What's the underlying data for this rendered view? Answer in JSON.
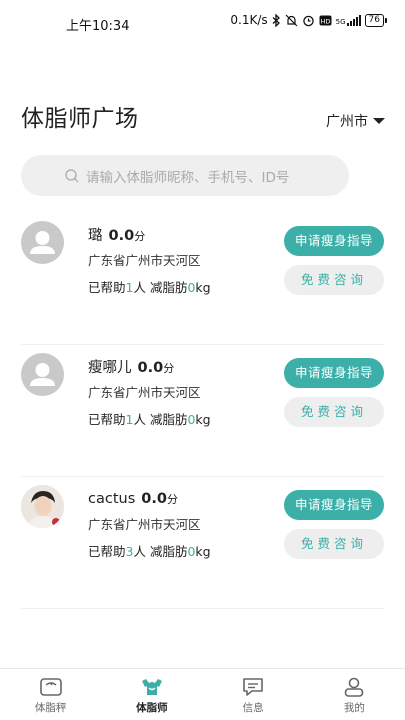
{
  "status_bar": {
    "time": "上午10:34",
    "network_speed": "0.1K/s",
    "network_type": "5G",
    "battery": "76"
  },
  "header": {
    "title": "体脂师广场",
    "city": "广州市"
  },
  "search": {
    "placeholder": "请输入体脂师昵称、手机号、ID号"
  },
  "coaches": [
    {
      "name": "璐",
      "score": "0.0",
      "score_unit": "分",
      "region": "广东省广州市天河区",
      "helped_prefix": "已帮助",
      "helped_count": "1",
      "helped_suffix": "人 减脂肪",
      "fat_lost": "0",
      "fat_unit": "kg",
      "apply_label": "申请瘦身指导",
      "consult_label": "免费咨询",
      "avatar": "default-avatar"
    },
    {
      "name": "瘦哪儿",
      "score": "0.0",
      "score_unit": "分",
      "region": "广东省广州市天河区",
      "helped_prefix": "已帮助",
      "helped_count": "1",
      "helped_suffix": "人 减脂肪",
      "fat_lost": "0",
      "fat_unit": "kg",
      "apply_label": "申请瘦身指导",
      "consult_label": "免费咨询",
      "avatar": "default-avatar"
    },
    {
      "name": "cactus",
      "score": "0.0",
      "score_unit": "分",
      "region": "广东省广州市天河区",
      "helped_prefix": "已帮助",
      "helped_count": "3",
      "helped_suffix": "人 减脂肪",
      "fat_lost": "0",
      "fat_unit": "kg",
      "apply_label": "申请瘦身指导",
      "consult_label": "免费咨询",
      "avatar": "photo-avatar"
    }
  ],
  "tabbar": [
    {
      "label": "体脂秤",
      "icon": "scale-icon",
      "active": false
    },
    {
      "label": "体脂师",
      "icon": "coach-icon",
      "active": true
    },
    {
      "label": "信息",
      "icon": "message-icon",
      "active": false
    },
    {
      "label": "我的",
      "icon": "profile-icon",
      "active": false
    }
  ],
  "colors": {
    "accent": "#3bafa8",
    "search_bg": "#efefef",
    "consult_bg": "#eeeeee"
  }
}
